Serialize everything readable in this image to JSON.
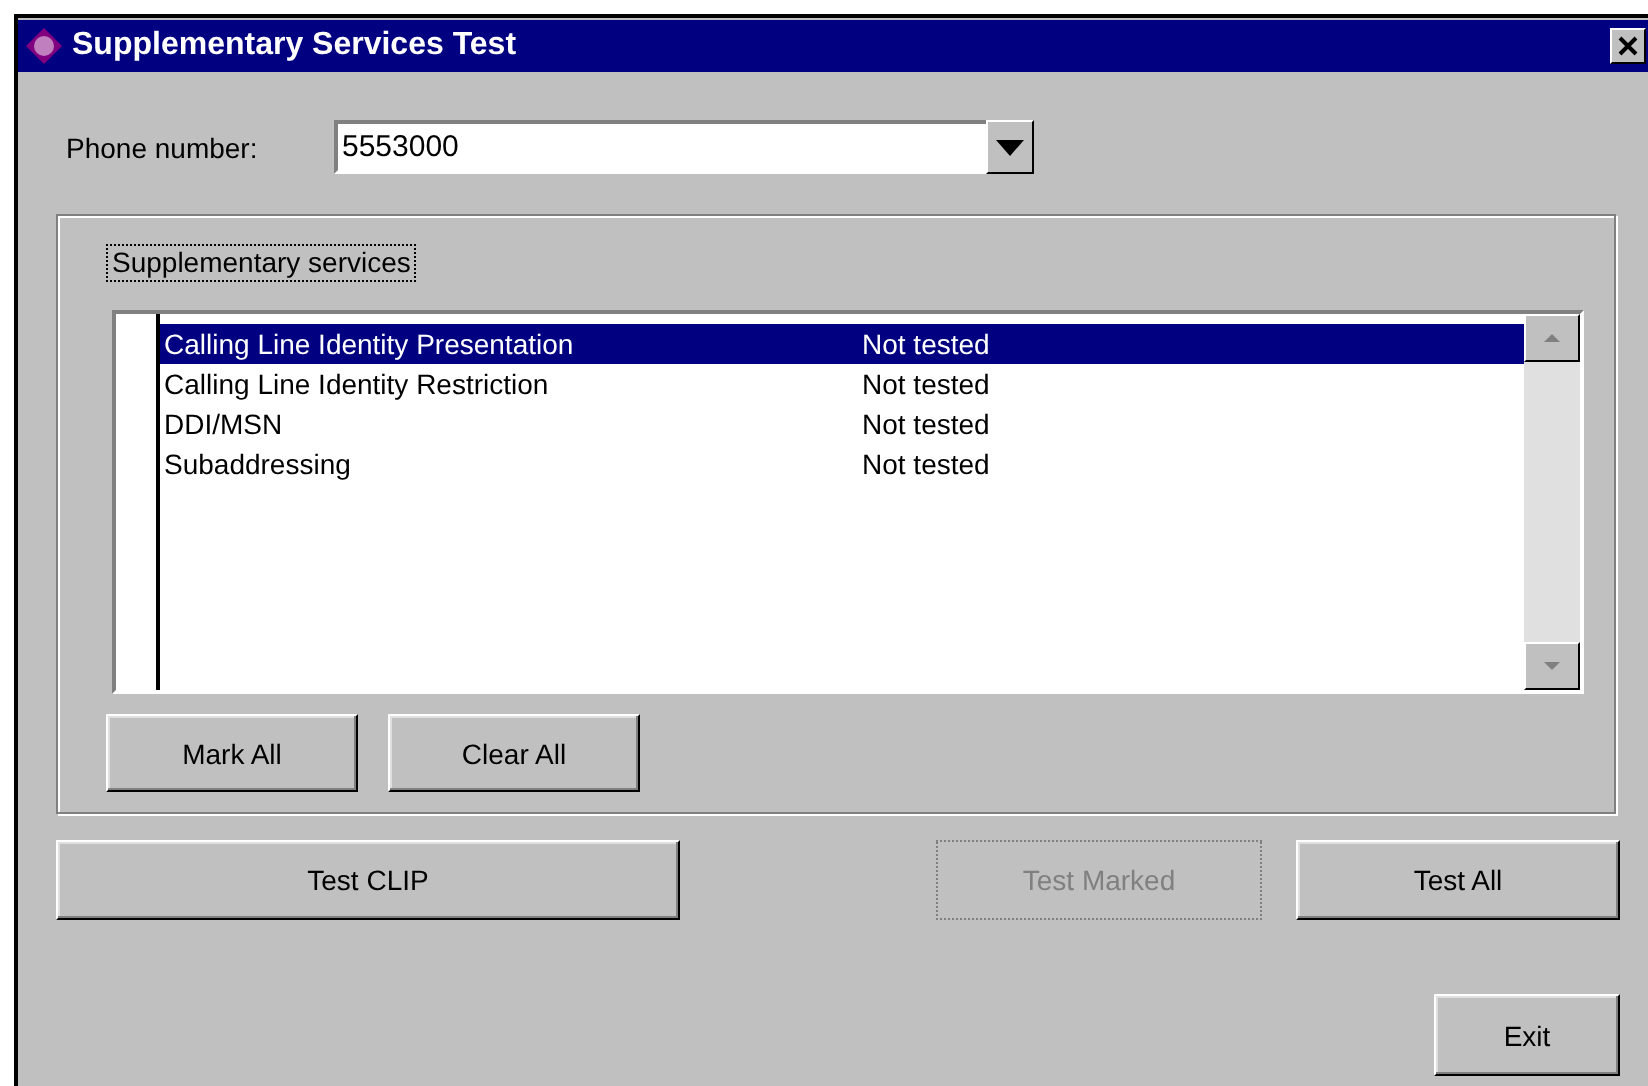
{
  "window": {
    "title": "Supplementary Services Test"
  },
  "phone_number": {
    "label": "Phone number:",
    "value": "5553000"
  },
  "services_group": {
    "label": "Supplementary services",
    "rows": [
      {
        "name": "Calling Line Identity Presentation",
        "status": "Not tested",
        "selected": true
      },
      {
        "name": "Calling Line Identity Restriction",
        "status": "Not tested",
        "selected": false
      },
      {
        "name": "DDI/MSN",
        "status": "Not tested",
        "selected": false
      },
      {
        "name": "Subaddressing",
        "status": "Not tested",
        "selected": false
      }
    ],
    "buttons": [
      {
        "label": "Mark All",
        "disabled": false
      },
      {
        "label": "Clear All",
        "disabled": false
      }
    ]
  },
  "action_buttons": [
    {
      "label": "Test CLIP",
      "disabled": false
    },
    {
      "label": "Test Marked",
      "disabled": true
    },
    {
      "label": "Test All",
      "disabled": false
    }
  ],
  "exit_button": {
    "label": "Exit"
  }
}
